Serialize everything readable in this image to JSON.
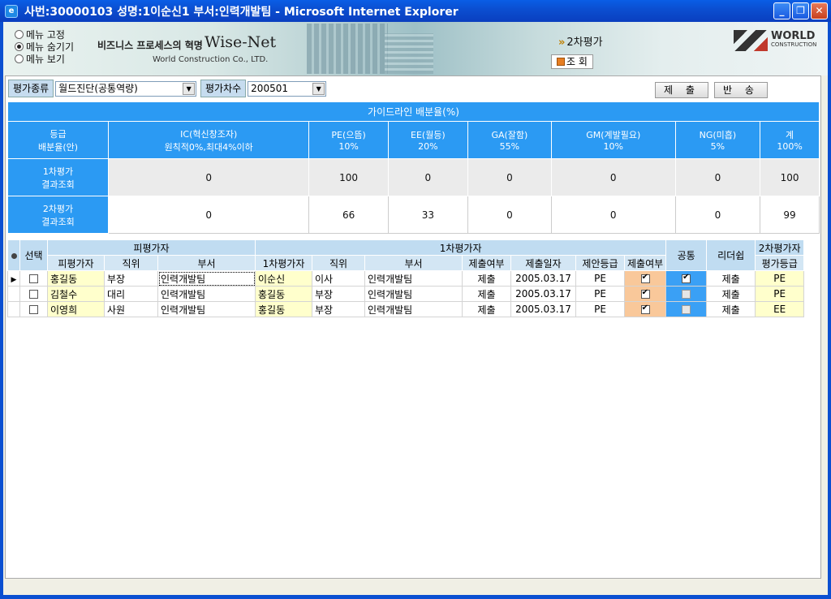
{
  "window": {
    "title": "사번:30000103 성명:1이순신1 부서:인력개발팀 - Microsoft Internet Explorer",
    "minimize": "_",
    "restore": "❐",
    "close": "✕"
  },
  "banner": {
    "menu": [
      {
        "label": "메뉴 고정",
        "selected": false
      },
      {
        "label": "메뉴 숨기기",
        "selected": true
      },
      {
        "label": "메뉴 보기",
        "selected": false
      }
    ],
    "slogan": "비즈니스 프로세스의 혁명",
    "brand": "Wise-Net",
    "company": "World Construction Co., LTD.",
    "current_page": "2차평가",
    "query_label": "조 회",
    "logo_text": "WORLD",
    "logo_sub": "CONSTRUCTION"
  },
  "filters": {
    "type_label": "평가종류",
    "type_value": "월드진단(공통역량)",
    "round_label": "평가차수",
    "round_value": "200501"
  },
  "actions": {
    "submit": "제 출",
    "return": "반 송"
  },
  "guide": {
    "title": "가이드라인 배분율(%)",
    "head": [
      "등급\n배분율(안)",
      "IC(혁신창조자)\n원칙적0%,최대4%이하",
      "PE(으뜸)\n10%",
      "EE(월등)\n20%",
      "GA(잘함)\n55%",
      "GM(계발필요)\n10%",
      "NG(미흡)\n5%",
      "계\n100%"
    ],
    "rows": [
      {
        "label": "1차평가\n결과조회",
        "values": [
          "0",
          "100",
          "0",
          "0",
          "0",
          "0",
          "100"
        ]
      },
      {
        "label": "2차평가\n결과조회",
        "values": [
          "0",
          "66",
          "33",
          "0",
          "0",
          "0",
          "99"
        ]
      }
    ]
  },
  "grid": {
    "groups": {
      "select": "선택",
      "evaluatee": "피평가자",
      "first": "1차평가자",
      "common": "공통",
      "leadership": "리더쉽",
      "second": "2차평가자"
    },
    "cols": {
      "name": "피평가자",
      "position": "직위",
      "dept": "부서",
      "first_name": "1차평가자",
      "first_position": "직위",
      "first_dept": "부서",
      "submitted": "제출여부",
      "date": "제출일자",
      "proposed": "제안등급",
      "second_submitted": "제출여부",
      "grade": "평가등급"
    },
    "rows": [
      {
        "name": "홍길동",
        "position": "부장",
        "dept": "인력개발팀",
        "first_name": "이순신",
        "first_position": "이사",
        "first_dept": "인력개발팀",
        "submitted": "제출",
        "date": "2005.03.17",
        "proposed": "PE",
        "common": true,
        "leadership": true,
        "second_submitted": "제출",
        "grade": "PE"
      },
      {
        "name": "김철수",
        "position": "대리",
        "dept": "인력개발팀",
        "first_name": "홍길동",
        "first_position": "부장",
        "first_dept": "인력개발팀",
        "submitted": "제출",
        "date": "2005.03.17",
        "proposed": "PE",
        "common": true,
        "leadership": false,
        "second_submitted": "제출",
        "grade": "PE"
      },
      {
        "name": "이영희",
        "position": "사원",
        "dept": "인력개발팀",
        "first_name": "홍길동",
        "first_position": "부장",
        "first_dept": "인력개발팀",
        "submitted": "제출",
        "date": "2005.03.17",
        "proposed": "PE",
        "common": true,
        "leadership": false,
        "second_submitted": "제출",
        "grade": "EE"
      }
    ]
  }
}
